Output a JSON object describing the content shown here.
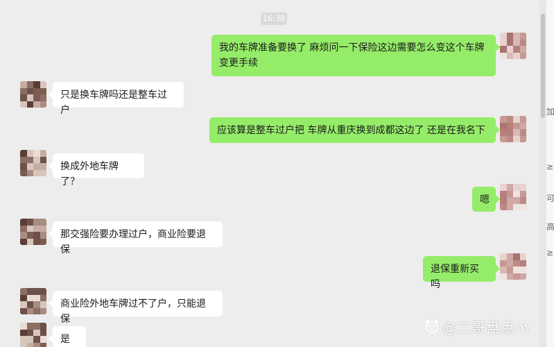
{
  "chat": {
    "timestamp": "16:38",
    "messages": [
      {
        "side": "out",
        "text": "我的车牌准备要换了  麻烦问一下保险这边需要怎么变这个车牌变更手续"
      },
      {
        "side": "in",
        "text": "只是换车牌吗还是整车过户"
      },
      {
        "side": "out",
        "text": "应该算是整车过户把  车牌从重庆换到成都这边了 还是在我名下"
      },
      {
        "side": "in",
        "text": "换成外地车牌了？"
      },
      {
        "side": "out",
        "text": "嗯"
      },
      {
        "side": "in",
        "text": "那交强险要办理过户，商业险要退保"
      },
      {
        "side": "out",
        "text": "退保重新买吗"
      },
      {
        "side": "in",
        "text": "商业险外地车牌过不了户，只能退保"
      },
      {
        "side": "in",
        "text": "是的"
      }
    ]
  },
  "watermark": {
    "text": "@二哥盘点m",
    "icon": "panda-logo-icon"
  },
  "right_strip": {
    "chars": [
      "加",
      "≥⊻",
      "可",
      "高",
      "≥"
    ]
  },
  "colors": {
    "background": "#ededed",
    "outgoing_bubble": "#95ec69",
    "incoming_bubble": "#ffffff",
    "timestamp_bg": "#dadada"
  }
}
